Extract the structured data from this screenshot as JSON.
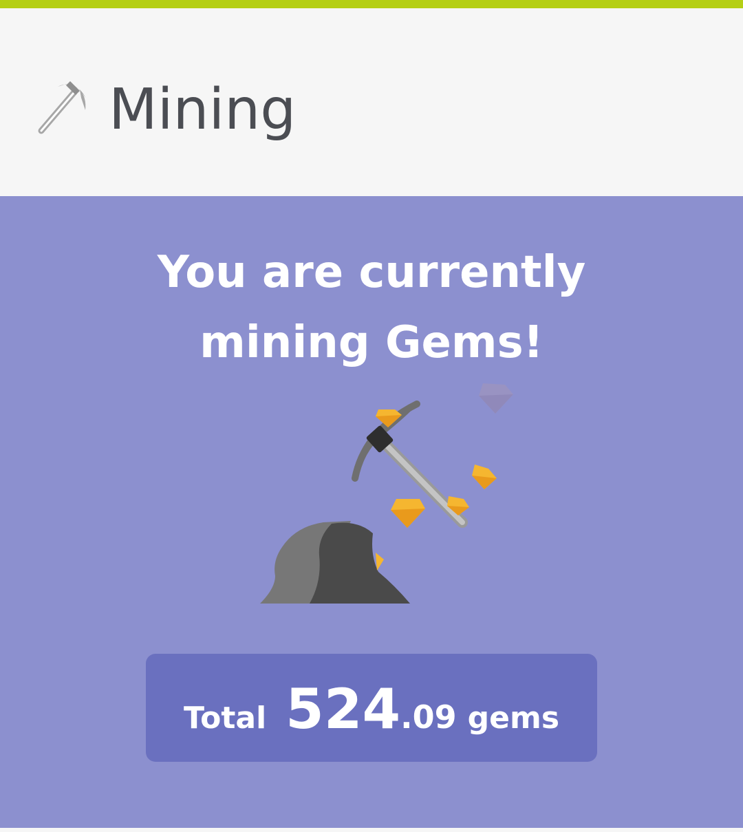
{
  "header": {
    "title": "Mining",
    "icon": "pickaxe-icon"
  },
  "status": {
    "line1": "You are currently",
    "line2": "mining Gems!"
  },
  "total": {
    "label": "Total",
    "integer_part": "524",
    "decimal_part": ".09",
    "unit": "gems"
  },
  "colors": {
    "accent": "#b5cf16",
    "panel": "#8c90cf",
    "total_box": "#6a70bf",
    "title_text": "#4b4d53",
    "gem": "#f5b630"
  }
}
